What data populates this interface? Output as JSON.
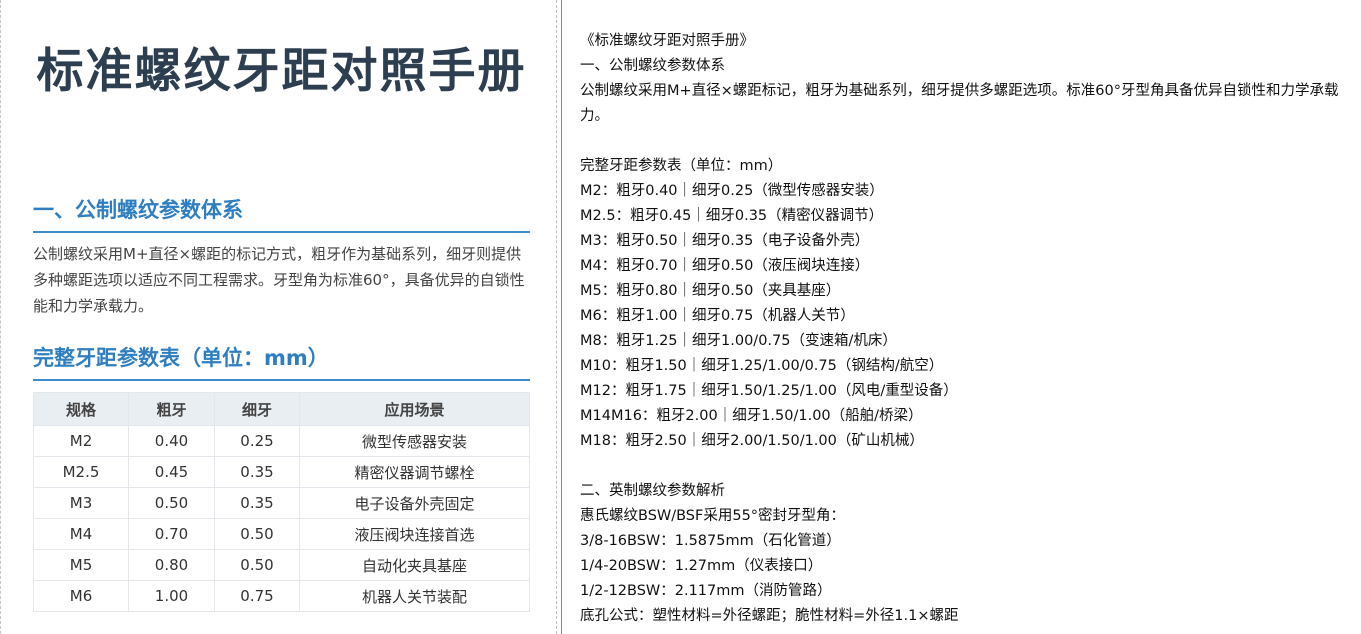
{
  "left": {
    "title": "标准螺纹牙距对照手册",
    "section1": {
      "heading": "一、公制螺纹参数体系",
      "paragraph": "公制螺纹采用M+直径×螺距的标记方式，粗牙作为基础系列，细牙则提供多种螺距选项以适应不同工程需求。牙型角为标准60°，具备优异的自锁性能和力学承载力。"
    },
    "section2": {
      "heading": "完整牙距参数表（单位：mm）",
      "columns": [
        "规格",
        "粗牙",
        "细牙",
        "应用场景"
      ],
      "rows": [
        [
          "M2",
          "0.40",
          "0.25",
          "微型传感器安装"
        ],
        [
          "M2.5",
          "0.45",
          "0.35",
          "精密仪器调节螺栓"
        ],
        [
          "M3",
          "0.50",
          "0.35",
          "电子设备外壳固定"
        ],
        [
          "M4",
          "0.70",
          "0.50",
          "液压阀块连接首选"
        ],
        [
          "M5",
          "0.80",
          "0.50",
          "自动化夹具基座"
        ],
        [
          "M6",
          "1.00",
          "0.75",
          "机器人关节装配"
        ]
      ]
    }
  },
  "right": {
    "lines": [
      "《标准螺纹牙距对照手册》",
      "一、公制螺纹参数体系",
      "公制螺纹采用M+直径×螺距标记，粗牙为基础系列，细牙提供多螺距选项。标准60°牙型角具备优异自锁性和力学承载力。",
      "",
      "完整牙距参数表（单位：mm）",
      "M2：粗牙0.40｜细牙0.25（微型传感器安装）",
      "M2.5：粗牙0.45｜细牙0.35（精密仪器调节）",
      "M3：粗牙0.50｜细牙0.35（电子设备外壳）",
      "M4：粗牙0.70｜细牙0.50（液压阀块连接）",
      "M5：粗牙0.80｜细牙0.50（夹具基座）",
      "M6：粗牙1.00｜细牙0.75（机器人关节）",
      "M8：粗牙1.25｜细牙1.00/0.75（变速箱/机床）",
      "M10：粗牙1.50｜细牙1.25/1.00/0.75（钢结构/航空）",
      "M12：粗牙1.75｜细牙1.50/1.25/1.00（风电/重型设备）",
      "M14M16：粗牙2.00｜细牙1.50/1.00（船舶/桥梁）",
      "M18：粗牙2.50｜细牙2.00/1.50/1.00（矿山机械）",
      "",
      "二、英制螺纹参数解析",
      "惠氏螺纹BSW/BSF采用55°密封牙型角：",
      "3/8-16BSW：1.5875mm（石化管道）",
      "1/4-20BSW：1.27mm（仪表接口）",
      "1/2-12BSW：2.117mm（消防管路）",
      "底孔公式：塑性材料=外径螺距；脆性材料=外径1.1×螺距"
    ]
  }
}
